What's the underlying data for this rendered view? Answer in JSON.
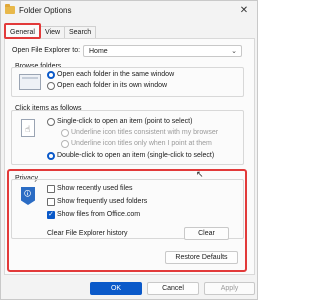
{
  "window": {
    "title": "Folder Options",
    "close_glyph": "✕"
  },
  "tabs": [
    {
      "label": "General",
      "active": true
    },
    {
      "label": "View",
      "active": false
    },
    {
      "label": "Search",
      "active": false
    }
  ],
  "general": {
    "open_explorer_label": "Open File Explorer to:",
    "open_explorer_value": "Home",
    "browse_folders": {
      "title": "Browse folders",
      "options": [
        {
          "label": "Open each folder in the same window",
          "selected": true
        },
        {
          "label": "Open each folder in its own window",
          "selected": false
        }
      ]
    },
    "click_items": {
      "title": "Click items as follows",
      "single_click": "Single-click to open an item (point to select)",
      "underline_browser": "Underline icon titles consistent with my browser",
      "underline_point": "Underline icon titles only when I point at them",
      "double_click": "Double-click to open an item (single-click to select)"
    },
    "privacy": {
      "title": "Privacy",
      "checks": [
        {
          "label": "Show recently used files",
          "checked": false
        },
        {
          "label": "Show frequently used folders",
          "checked": false
        },
        {
          "label": "Show files from Office.com",
          "checked": true
        }
      ],
      "clear_history_label": "Clear File Explorer history",
      "clear_button": "Clear"
    },
    "restore_defaults": "Restore Defaults"
  },
  "footer": {
    "ok": "OK",
    "cancel": "Cancel",
    "apply": "Apply"
  },
  "colors": {
    "accent": "#0a59c9",
    "highlight_red": "#e23a3a"
  },
  "icons": {
    "check_glyph": "✓",
    "dropdown_glyph": "⌄",
    "cursor_glyph": "↖"
  }
}
